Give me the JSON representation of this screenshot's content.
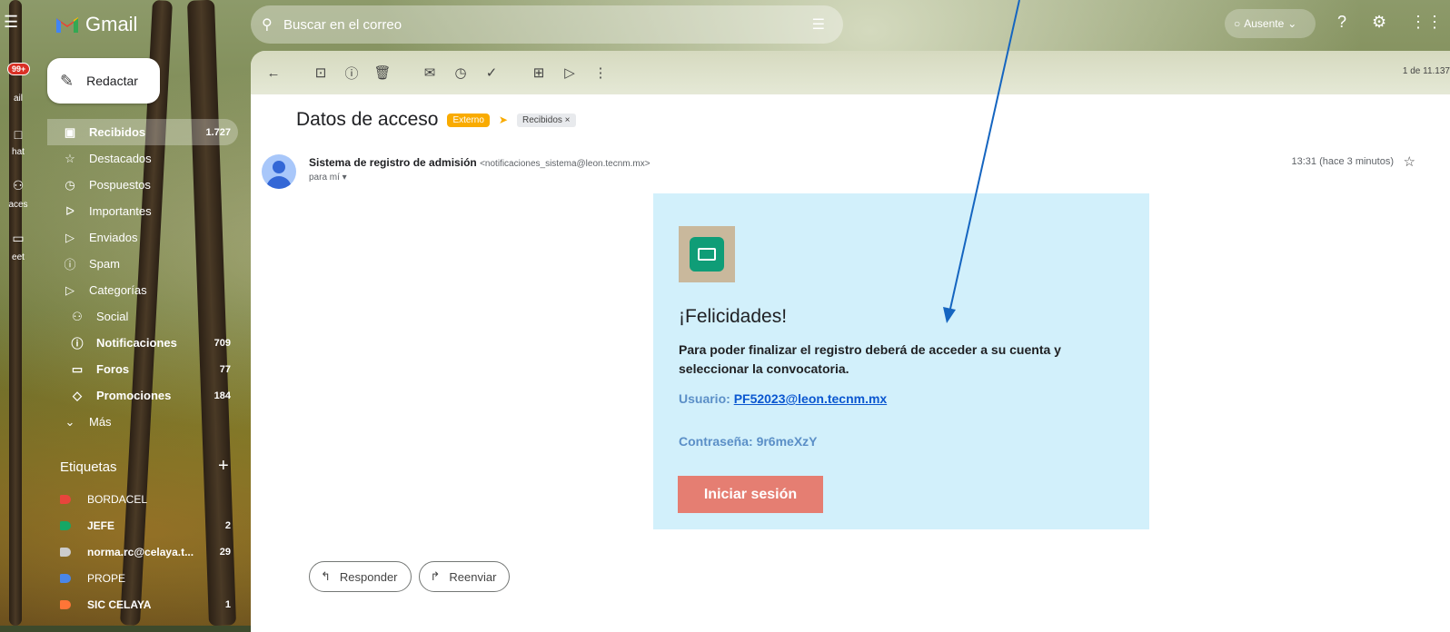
{
  "app": {
    "name": "Gmail"
  },
  "rail": {
    "badge": "99+",
    "items": [
      "ail",
      "hat",
      "aces",
      "eet"
    ]
  },
  "search": {
    "placeholder": "Buscar en el correo"
  },
  "status": {
    "label": "Ausente"
  },
  "compose": {
    "label": "Redactar"
  },
  "nav": [
    {
      "label": "Recibidos",
      "count": "1.727",
      "icon": "inbox-icon",
      "active": true
    },
    {
      "label": "Destacados",
      "icon": "star-icon"
    },
    {
      "label": "Pospuestos",
      "icon": "clock-icon"
    },
    {
      "label": "Importantes",
      "icon": "important-icon"
    },
    {
      "label": "Enviados",
      "icon": "send-icon"
    },
    {
      "label": "Spam",
      "icon": "spam-icon"
    },
    {
      "label": "Categorías",
      "icon": "label-icon"
    },
    {
      "label": "Social",
      "icon": "people-icon",
      "sub": true
    },
    {
      "label": "Notificaciones",
      "count": "709",
      "icon": "info-icon",
      "sub": true,
      "bold": true
    },
    {
      "label": "Foros",
      "count": "77",
      "icon": "forum-icon",
      "sub": true,
      "bold": true
    },
    {
      "label": "Promociones",
      "count": "184",
      "icon": "tag-icon",
      "sub": true,
      "bold": true
    },
    {
      "label": "Más",
      "icon": "chevron-down-icon"
    }
  ],
  "labels": {
    "heading": "Etiquetas",
    "items": [
      {
        "name": "BORDACEL",
        "color": "#e8453c"
      },
      {
        "name": "JEFE",
        "count": "2",
        "color": "#16a765"
      },
      {
        "name": "norma.rc@celaya.t...",
        "count": "29",
        "color": "#cccccc"
      },
      {
        "name": "PROPE",
        "color": "#4a86e8"
      },
      {
        "name": "SIC CELAYA",
        "count": "1",
        "color": "#ff7537"
      }
    ]
  },
  "toolbar": {
    "pager": "1 de 11.137"
  },
  "message": {
    "subject": "Datos de acceso",
    "external_tag": "Externo",
    "label_chip": "Recibidos ×",
    "sender_name": "Sistema de registro de admisión",
    "sender_email": "<notificaciones_sistema@leon.tecnm.mx>",
    "to": "para mí ▾",
    "time": "13:31 (hace 3 minutos)"
  },
  "email_card": {
    "heading": "¡Felicidades!",
    "body": "Para poder finalizar el registro deberá de acceder a su cuenta y seleccionar la convocatoria.",
    "user_label": "Usuario: ",
    "user_value": "PF52023@leon.tecnm.mx",
    "password_label": "Contraseña: 9r6meXzY",
    "button": "Iniciar sesión"
  },
  "actions": {
    "reply": "Responder",
    "forward": "Reenviar"
  },
  "colors": {
    "card_bg": "#d2f0fb",
    "button": "#e57e72",
    "accent_tag": "#f9ab00",
    "arrow": "#1565c0"
  }
}
